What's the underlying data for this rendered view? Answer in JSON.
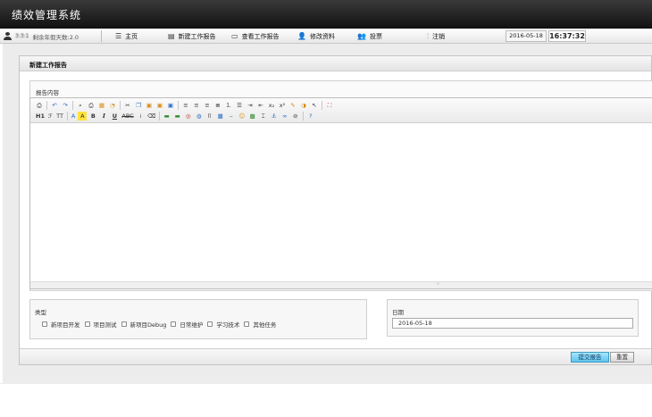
{
  "app": {
    "title": "绩效管理系统"
  },
  "user": {
    "name": "3:3:1",
    "info": "剩余年假天数:2.0"
  },
  "nav": [
    {
      "icon": "list-icon",
      "glyph": "☰",
      "label": "主页"
    },
    {
      "icon": "report-new-icon",
      "glyph": "▤",
      "label": "新建工作报告"
    },
    {
      "icon": "folder-icon",
      "glyph": "▭",
      "label": "查看工作报告"
    },
    {
      "icon": "user-edit-icon",
      "glyph": "👤",
      "label": "修改资料"
    },
    {
      "icon": "vote-icon",
      "glyph": "👥",
      "label": "投票"
    },
    {
      "icon": "logout-icon",
      "glyph": "⫶",
      "label": "注销"
    }
  ],
  "status": {
    "date": "2016-05-18",
    "time": "16:37:32"
  },
  "form": {
    "panel_title": "新建工作报告",
    "content_label": "报告内容",
    "type_label": "类型",
    "types": [
      "新项目开发",
      "项目测试",
      "新项目Debug",
      "日常维护",
      "学习技术",
      "其他任务"
    ],
    "date_label": "日期",
    "date_value": "2016-05-18",
    "submit_label": "提交报告",
    "reset_label": "重置"
  },
  "toolbar": {
    "row1": [
      {
        "name": "source-icon",
        "glyph": "⎙"
      },
      {
        "sep": true
      },
      {
        "name": "undo-icon",
        "glyph": "↶",
        "cls": "blue"
      },
      {
        "name": "redo-icon",
        "glyph": "↷",
        "cls": "blue"
      },
      {
        "sep": true
      },
      {
        "name": "preview-icon",
        "glyph": "⌕"
      },
      {
        "name": "print-icon",
        "glyph": "⎙"
      },
      {
        "name": "template-icon",
        "glyph": "▦",
        "cls": "orange"
      },
      {
        "name": "code-icon",
        "glyph": "◔",
        "cls": "orange"
      },
      {
        "sep": true
      },
      {
        "name": "cut-icon",
        "glyph": "✂"
      },
      {
        "name": "copy-icon",
        "glyph": "❐",
        "cls": "blue"
      },
      {
        "name": "paste-icon",
        "glyph": "▣",
        "cls": "orange"
      },
      {
        "name": "paste-text-icon",
        "glyph": "▣",
        "cls": "orange"
      },
      {
        "name": "paste-word-icon",
        "glyph": "▣",
        "cls": "blue"
      },
      {
        "sep": true
      },
      {
        "name": "align-left-icon",
        "glyph": "≡"
      },
      {
        "name": "align-center-icon",
        "glyph": "≡"
      },
      {
        "name": "align-right-icon",
        "glyph": "≡"
      },
      {
        "name": "align-justify-icon",
        "glyph": "≣"
      },
      {
        "name": "ordered-list-icon",
        "glyph": "⒈"
      },
      {
        "name": "unordered-list-icon",
        "glyph": "☰"
      },
      {
        "name": "indent-icon",
        "glyph": "⇥"
      },
      {
        "name": "outdent-icon",
        "glyph": "⇤"
      },
      {
        "name": "subscript-icon",
        "glyph": "x₂"
      },
      {
        "name": "superscript-icon",
        "glyph": "x²"
      },
      {
        "name": "clear-format-icon",
        "glyph": "✎",
        "cls": "orange"
      },
      {
        "name": "select-all-icon",
        "glyph": "◑",
        "cls": "orange"
      },
      {
        "name": "pointer-icon",
        "glyph": "↖"
      },
      {
        "sep": true
      },
      {
        "name": "fullscreen-icon",
        "glyph": "⛶",
        "cls": "red"
      }
    ],
    "row2": [
      {
        "name": "heading-icon",
        "glyph": "H1",
        "cls": "wide b"
      },
      {
        "name": "font-family-icon",
        "glyph": "ℱ",
        "cls": "wide"
      },
      {
        "name": "font-size-icon",
        "glyph": "TT",
        "cls": "wide"
      },
      {
        "sep": true
      },
      {
        "name": "font-color-icon",
        "glyph": "A",
        "cls": "wide blue"
      },
      {
        "name": "highlight-icon",
        "glyph": "A",
        "cls": "hl"
      },
      {
        "name": "bold-icon",
        "glyph": "B",
        "cls": "b"
      },
      {
        "name": "italic-icon",
        "glyph": "I",
        "cls": "i b"
      },
      {
        "name": "underline-icon",
        "glyph": "U",
        "cls": "u b"
      },
      {
        "name": "strikethrough-icon",
        "glyph": "ABC",
        "cls": "s wide"
      },
      {
        "name": "line-height-icon",
        "glyph": "⁞"
      },
      {
        "name": "remove-format-icon",
        "glyph": "⌫"
      },
      {
        "sep": true
      },
      {
        "name": "image-icon",
        "glyph": "▬",
        "cls": "green"
      },
      {
        "name": "multi-image-icon",
        "glyph": "▬",
        "cls": "green"
      },
      {
        "name": "flash-icon",
        "glyph": "◎",
        "cls": "red"
      },
      {
        "name": "media-icon",
        "glyph": "◍",
        "cls": "blue"
      },
      {
        "name": "file-icon",
        "glyph": "⌷"
      },
      {
        "name": "table-icon",
        "glyph": "▦",
        "cls": "blue"
      },
      {
        "name": "hr-icon",
        "glyph": "⎯",
        "cls": "green"
      },
      {
        "name": "emoticon-icon",
        "glyph": "☺",
        "cls": "orange"
      },
      {
        "name": "baidu-map-icon",
        "glyph": "▩",
        "cls": "green"
      },
      {
        "name": "page-break-icon",
        "glyph": "⌶"
      },
      {
        "name": "anchor-icon",
        "glyph": "⚓",
        "cls": "blue"
      },
      {
        "name": "link-icon",
        "glyph": "∞",
        "cls": "blue"
      },
      {
        "name": "unlink-icon",
        "glyph": "⊘"
      },
      {
        "sep": true
      },
      {
        "name": "help-icon",
        "glyph": "?",
        "cls": "blue"
      }
    ]
  }
}
